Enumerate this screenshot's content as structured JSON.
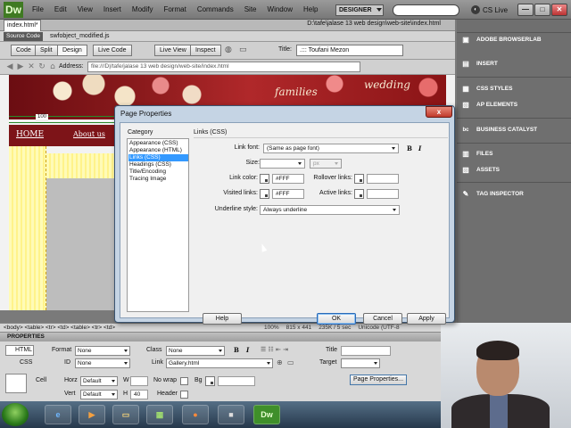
{
  "app": {
    "logo": "Dw",
    "menu": [
      "File",
      "Edit",
      "View",
      "Insert",
      "Modify",
      "Format",
      "Commands",
      "Site",
      "Window",
      "Help"
    ],
    "workspace": "DESIGNER",
    "cs_live": "CS Live",
    "min_glyph": "—",
    "max_glyph": "□",
    "close_glyph": "✕"
  },
  "document": {
    "tab": "index.html*",
    "tab_close": "×",
    "path": "D:\\tafe\\jalase 13 web design\\web-site\\index.html",
    "source_code_label": "Source Code",
    "related_file": "swfobject_modified.js",
    "view_buttons": [
      "Code",
      "Split",
      "Design",
      "Live Code",
      "Live View",
      "Inspect"
    ],
    "title_label": "Title:",
    "title_value": ".::: Toufani Mezon",
    "address_label": "Address:",
    "address_value": "file:///D|/tafe/jalase 13 web design/web-site/index.html"
  },
  "canvas": {
    "banner_text_1": "families",
    "banner_text_2": "wedding",
    "ruler_value": "100",
    "nav_home": "HOME",
    "nav_about": "About us"
  },
  "status_bar": {
    "tags": "<body> <table> <tr> <td> <table> <tr> <td>",
    "zoom": "100%",
    "size": "815 x 441",
    "weight": "235K / 5 sec",
    "encoding": "Unicode (UTF-8"
  },
  "properties": {
    "title": "PROPERTIES",
    "html_btn": "HTML",
    "css_btn": "CSS",
    "format_label": "Format",
    "format_value": "None",
    "class_label": "Class",
    "class_value": "None",
    "bold": "B",
    "italic": "I",
    "title_label": "Title",
    "id_label": "ID",
    "id_value": "None",
    "link_label": "Link",
    "link_value": "Gallery.html",
    "target_label": "Target",
    "cell_label": "Cell",
    "horz_label": "Horz",
    "horz_value": "Default",
    "w_label": "W",
    "nowrap_label": "No wrap",
    "bg_label": "Bg",
    "vert_label": "Vert",
    "vert_value": "Default",
    "h_label": "H",
    "h_value": "40",
    "header_label": "Header",
    "page_props_btn": "Page Properties..."
  },
  "panels": [
    {
      "label": "ADOBE BROWSERLAB",
      "icon": "browserlab-icon",
      "glyph": "▣"
    },
    {
      "label": "INSERT",
      "icon": "insert-icon",
      "glyph": "▤"
    },
    {
      "label": "CSS STYLES",
      "icon": "css-styles-icon",
      "glyph": "▦"
    },
    {
      "label": "AP ELEMENTS",
      "icon": "ap-elements-icon",
      "glyph": "▧"
    },
    {
      "label": "BUSINESS CATALYST",
      "icon": "business-catalyst-icon",
      "glyph": "bc"
    },
    {
      "label": "FILES",
      "icon": "files-icon",
      "glyph": "▥"
    },
    {
      "label": "ASSETS",
      "icon": "assets-icon",
      "glyph": "▨"
    },
    {
      "label": "TAG INSPECTOR",
      "icon": "tag-inspector-icon",
      "glyph": "✎"
    }
  ],
  "dialog": {
    "title": "Page Properties",
    "close_glyph": "x",
    "category_label": "Category",
    "categories": [
      "Appearance (CSS)",
      "Appearance (HTML)",
      "Links (CSS)",
      "Headings (CSS)",
      "Title/Encoding",
      "Tracing Image"
    ],
    "selected_category": "Links (CSS)",
    "section_title": "Links (CSS)",
    "link_font_label": "Link font:",
    "link_font_value": "(Same as page font)",
    "bold": "B",
    "italic": "I",
    "size_label": "Size:",
    "size_unit": "px",
    "link_color_label": "Link color:",
    "link_color_value": "#FFF",
    "rollover_label": "Rollover links:",
    "visited_label": "Visited links:",
    "visited_value": "#FFF",
    "active_label": "Active links:",
    "underline_label": "Underline style:",
    "underline_value": "Always underline",
    "help_btn": "Help",
    "ok_btn": "OK",
    "cancel_btn": "Cancel",
    "apply_btn": "Apply"
  },
  "taskbar": {
    "apps": [
      {
        "name": "taskbar-ie",
        "glyph": "e",
        "color": "#2a7fd4"
      },
      {
        "name": "taskbar-media-player",
        "glyph": "▶",
        "color": "#f08020"
      },
      {
        "name": "taskbar-explorer",
        "glyph": "▭",
        "color": "#e8c060"
      },
      {
        "name": "taskbar-app-green",
        "glyph": "▦",
        "color": "#6fbf3f"
      },
      {
        "name": "taskbar-firefox",
        "glyph": "●",
        "color": "#e06a1a"
      },
      {
        "name": "taskbar-camera",
        "glyph": "■",
        "color": "#333333"
      },
      {
        "name": "taskbar-dreamweaver",
        "glyph": "Dw",
        "color": "#3f8f2a"
      }
    ]
  },
  "colors": {
    "dw_green": "#4a8a2a",
    "selection": "#3399ff",
    "banner_red": "#8a1a1c"
  }
}
